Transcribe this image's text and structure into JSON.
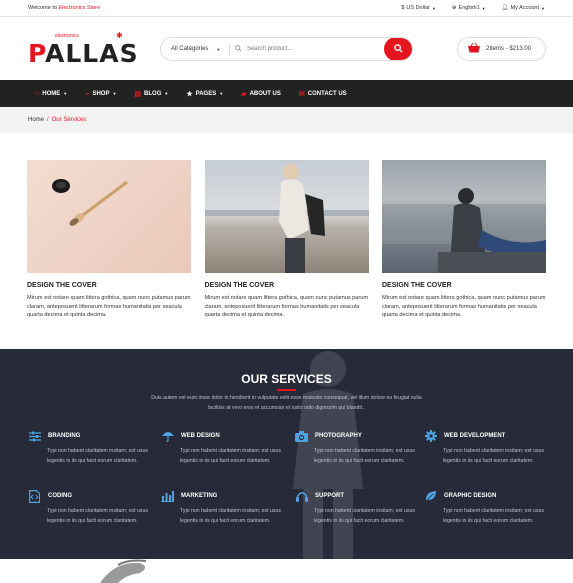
{
  "topbar": {
    "welcome_prefix": "Welcome to",
    "welcome_brand": "Electronics Store",
    "currency": "US Dollar",
    "language": "English1",
    "account": "My Account"
  },
  "logo": {
    "text_p": "P",
    "text_rest": "ALLAS",
    "sup": "electronics"
  },
  "search": {
    "category": "All Categories",
    "placeholder": "Search product..."
  },
  "cart": {
    "label": "2Items - $213.00"
  },
  "nav": [
    {
      "label": "HOME",
      "icon": "home-icon"
    },
    {
      "label": "SHOP",
      "icon": "basket-icon"
    },
    {
      "label": "BLOG",
      "icon": "book-icon"
    },
    {
      "label": "PAGES",
      "icon": "star-icon"
    },
    {
      "label": "ABOUT US",
      "icon": "chat-icon"
    },
    {
      "label": "CONTACT US",
      "icon": "mail-icon"
    }
  ],
  "breadcrumb": {
    "home": "Home",
    "sep": "/",
    "current": "Our Services"
  },
  "cards": [
    {
      "title": "DESIGN THE COVER",
      "text": "Mirum est notare quam littera gothica, quam nunc putamus parum claram, anteposuerit litterarum formas humanitatis per seacula quarta decima et quinta decima."
    },
    {
      "title": "DESIGN THE COVER",
      "text": "Mirum est notare quam littera gothica, quam nunc putamus parum claram, anteposuerit litterarum formas humanitatis per seacula quarta decima et quinta decima."
    },
    {
      "title": "DESIGN THE COVER",
      "text": "Mirum est notare quam littera gothica, quam nunc putamus parum claram, anteposuerit litterarum formas humanitatis per seacula quarta decima et quinta decima."
    }
  ],
  "services": {
    "title": "OUR SERVICES",
    "intro": "Duis autem vel eum iriure dolor in hendrerit in vulputate velit esse molestie consequat, vel illum dolore eu feugiat nulla facilisis at vero eros et accumsan et iusto odio dignissim qui blandit..",
    "items": [
      {
        "title": "BRANDING",
        "icon": "sliders-icon",
        "text": "Typi non habent claritatem insitam; est usus legentis in iis qui facit eorum claritatem."
      },
      {
        "title": "WEB DESIGN",
        "icon": "umbrella-icon",
        "text": "Typi non habent claritatem insitam; est usus legentis in iis qui facit eorum claritatem."
      },
      {
        "title": "PHOTOGRAPHY",
        "icon": "camera-icon",
        "text": "Typi non habent claritatem insitam; est usus legentis in iis qui facit eorum claritatem."
      },
      {
        "title": "WEB DEVELOPMENT",
        "icon": "gear-icon",
        "text": "Typi non habent claritatem insitam; est usus legentis in iis qui facit eorum claritatem."
      },
      {
        "title": "CODING",
        "icon": "code-file-icon",
        "text": "Typi non habent claritatem insitam; est usus legentis in iis qui facit eorum claritatem."
      },
      {
        "title": "MARKETING",
        "icon": "bar-chart-icon",
        "text": "Typi non habent claritatem insitam; est usus legentis in iis qui facit eorum claritatem."
      },
      {
        "title": "SUPPORT",
        "icon": "headset-icon",
        "text": "Typi non habent claritatem insitam; est usus legentis in iis qui facit eorum claritatem."
      },
      {
        "title": "GRAPHIC DESIGN",
        "icon": "leaf-icon",
        "text": "Typi non habent claritatem insitam; est usus legentis in iis qui facit eorum claritatem."
      }
    ]
  },
  "colors": {
    "accent": "#e4151f",
    "nav_bg": "#222222",
    "services_bg": "#262a39",
    "icon_blue": "#4fa3e0"
  }
}
